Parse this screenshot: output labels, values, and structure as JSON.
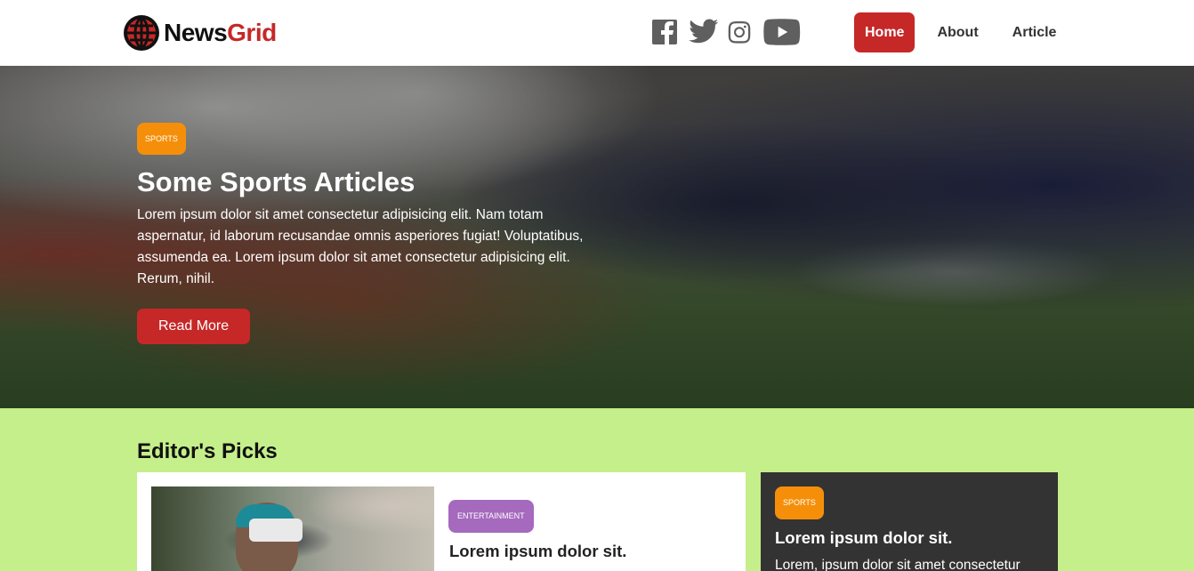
{
  "header": {
    "logo_part1": "News",
    "logo_part2": "Grid",
    "socials": [
      "facebook-icon",
      "twitter-icon",
      "instagram-icon",
      "youtube-icon"
    ],
    "nav": [
      {
        "label": "Home",
        "active": true
      },
      {
        "label": "About",
        "active": false
      },
      {
        "label": "Article",
        "active": false
      }
    ]
  },
  "hero": {
    "badge": "SPORTS",
    "title": "Some Sports Articles",
    "text": "Lorem ipsum dolor sit amet consectetur adipisicing elit. Nam totam aspernatur, id laborum recusandae omnis asperiores fugiat! Voluptatibus, assumenda ea. Lorem ipsum dolor sit amet consectetur adipisicing elit. Rerum, nihil.",
    "button": "Read More"
  },
  "picks": {
    "heading": "Editor's Picks",
    "main_card": {
      "badge": "ENTERTAINMENT",
      "title": "Lorem ipsum dolor sit."
    },
    "side_card": {
      "badge": "SPORTS",
      "title": "Lorem ipsum dolor sit.",
      "text": "Lorem, ipsum dolor sit amet consectetur"
    }
  },
  "colors": {
    "brand_red": "#c62828",
    "sports_badge": "#f58f0a",
    "entertainment_badge": "#a569bd",
    "page_bg": "#c5ef8a",
    "dark_card": "#333333"
  }
}
